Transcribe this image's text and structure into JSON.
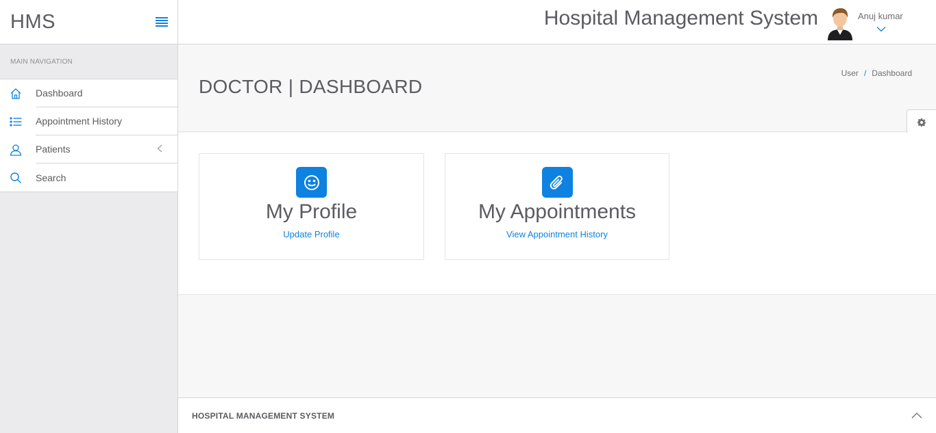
{
  "brand": {
    "name": "HMS",
    "toggle_icon": "hamburger-icon"
  },
  "sidebar": {
    "heading": "MAIN NAVIGATION",
    "items": [
      {
        "label": "Dashboard",
        "icon": "home-icon"
      },
      {
        "label": "Appointment History",
        "icon": "list-icon"
      },
      {
        "label": "Patients",
        "icon": "user-icon",
        "chevron": "chevron-left-icon"
      },
      {
        "label": "Search",
        "icon": "search-icon"
      }
    ]
  },
  "header": {
    "app_title": "Hospital Management System",
    "user_name": "Anuj kumar"
  },
  "page": {
    "title": "DOCTOR | DASHBOARD",
    "breadcrumb": [
      "User",
      "/",
      "Dashboard"
    ]
  },
  "cards": [
    {
      "title": "My Profile",
      "link": "Update Profile",
      "icon": "smile-icon"
    },
    {
      "title": "My Appointments",
      "link": "View Appointment History",
      "icon": "paperclip-icon"
    }
  ],
  "footer": {
    "text": "HOSPITAL MANAGEMENT SYSTEM"
  },
  "colors": {
    "accent": "#0d82e0",
    "text": "#5b5b60",
    "background": "#f7f7f8"
  }
}
